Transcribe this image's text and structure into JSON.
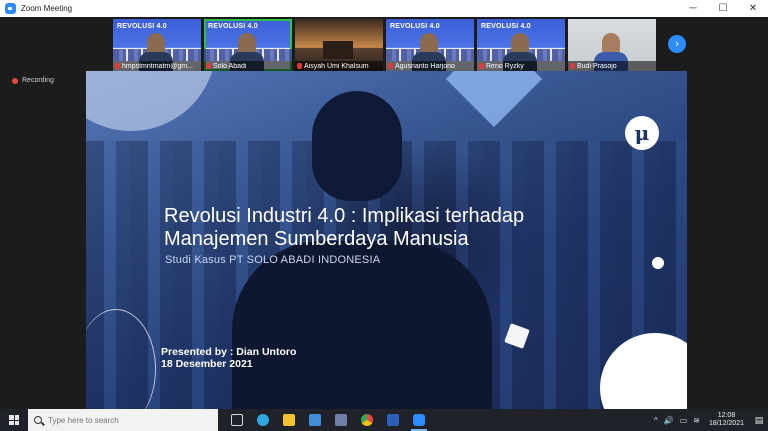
{
  "window": {
    "title": "Zoom Meeting",
    "minimize": "─",
    "maximize": "☐",
    "close": "✕"
  },
  "participants": [
    {
      "name": "hmpstmntmatm@gm...",
      "style": "poster",
      "banner": "REVOLUSI 4.0"
    },
    {
      "name": "Solo Abadi",
      "style": "poster",
      "banner": "REVOLUSI 4.0",
      "active": true
    },
    {
      "name": "Aisyah Umi Khalsum",
      "style": "sunset"
    },
    {
      "name": "Agusrianto Harjono",
      "style": "poster",
      "banner": "REVOLUSI 4.0"
    },
    {
      "name": "Reno Ryzky",
      "style": "poster",
      "banner": "REVOLUSI 4.0"
    },
    {
      "name": "Budi Prasojo",
      "style": "office"
    }
  ],
  "next_page_icon": "›",
  "recording": {
    "label": "Recording"
  },
  "slide": {
    "title_line1": "Revolusi Industri 4.0 : Implikasi terhadap",
    "title_line2": "Manajemen Sumberdaya Manusia",
    "subtitle": "Studi Kasus PT SOLO ABADI INDONESIA",
    "presenter_line1": "Presented by : Dian Untoro",
    "presenter_line2": "18 Desember 2021",
    "brand_glyph": "μ"
  },
  "taskbar": {
    "search_placeholder": "Type here to search",
    "apps": [
      {
        "name": "task-view",
        "color": "#cfd6e0"
      },
      {
        "name": "edge",
        "color": "#2fa6e0"
      },
      {
        "name": "file-explorer",
        "color": "#f2c231"
      },
      {
        "name": "mail",
        "color": "#3f8fd8"
      },
      {
        "name": "store",
        "color": "#6e7fa8"
      },
      {
        "name": "chrome",
        "color": "#e5483a"
      },
      {
        "name": "word",
        "color": "#2b5fb8"
      },
      {
        "name": "zoom",
        "color": "#2d8cff",
        "active": true
      }
    ],
    "tray": {
      "up_arrow": "^",
      "volume": "🔊",
      "network": "≋",
      "battery": "▭"
    },
    "time": "12:08",
    "date": "18/12/2021",
    "notification": "▤"
  }
}
